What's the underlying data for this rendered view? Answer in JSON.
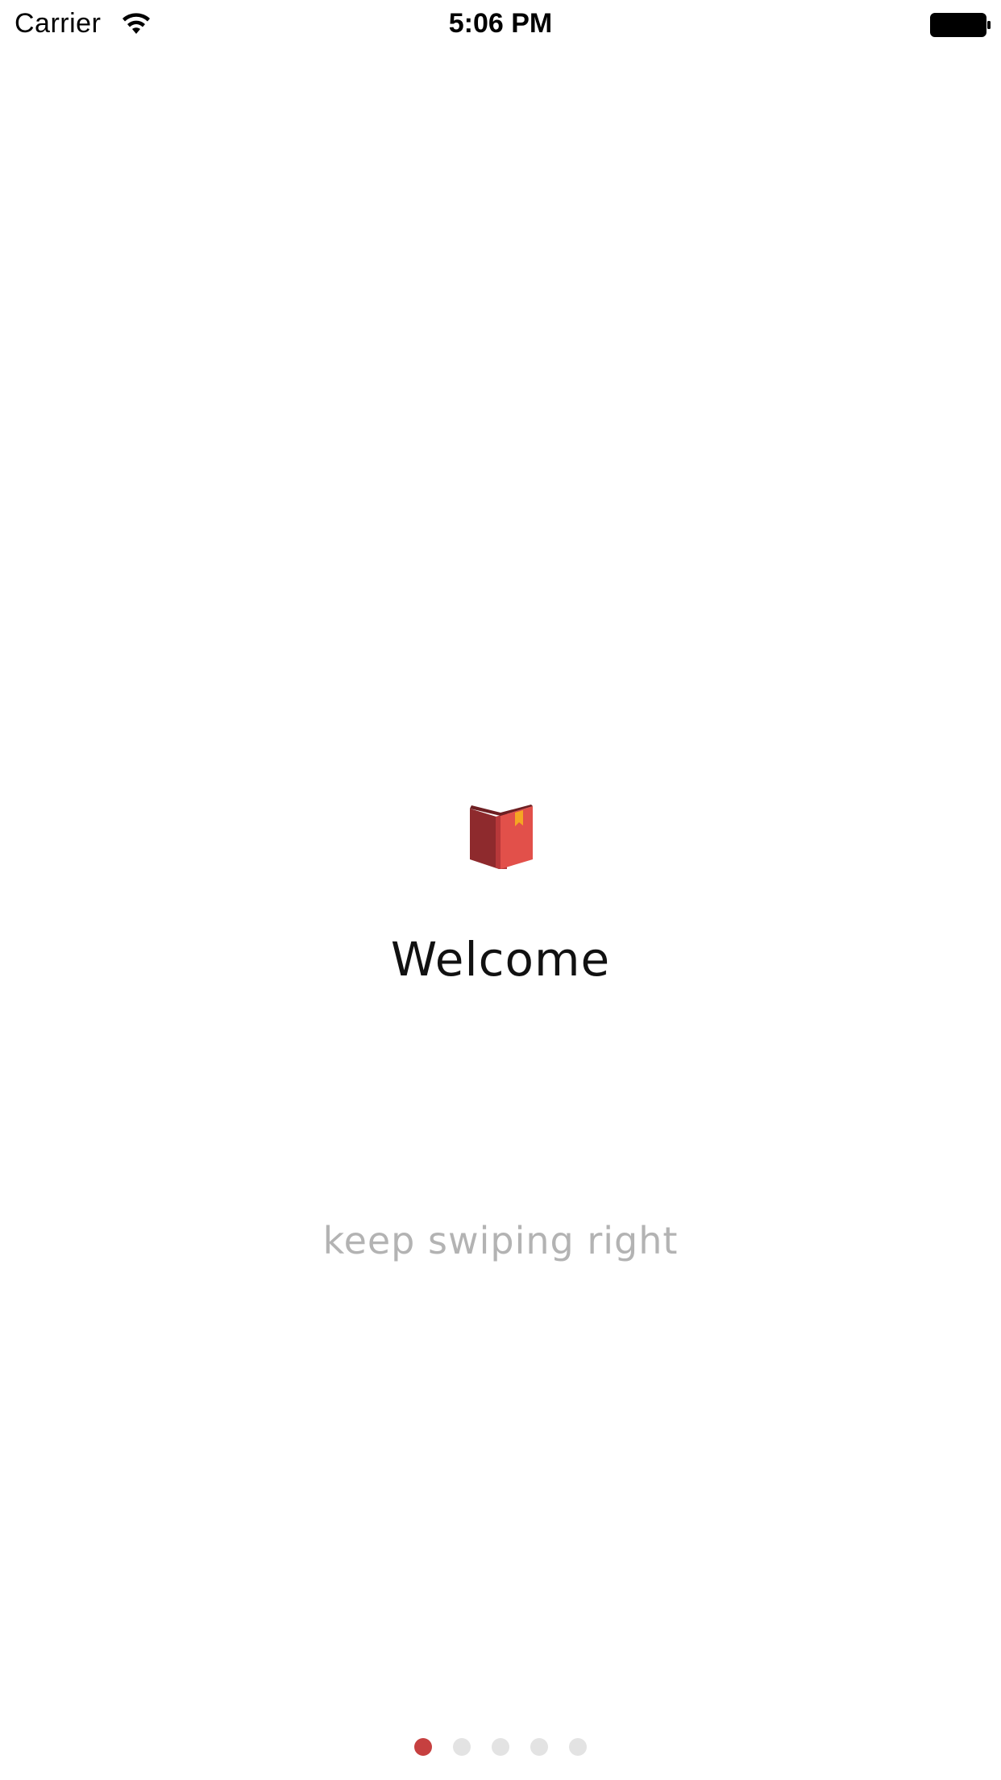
{
  "status_bar": {
    "carrier": "Carrier",
    "time": "5:06 PM",
    "wifi_icon": "wifi-icon",
    "battery_icon": "battery-full-icon"
  },
  "onboarding": {
    "icon": "book-icon",
    "title": "Welcome",
    "subtitle": "keep swiping right"
  },
  "page_control": {
    "total_pages": 5,
    "current_page": 1
  },
  "colors": {
    "accent": "#c64040",
    "dot_inactive": "#e3e3e3",
    "subtitle_text": "#b3b3b3"
  }
}
